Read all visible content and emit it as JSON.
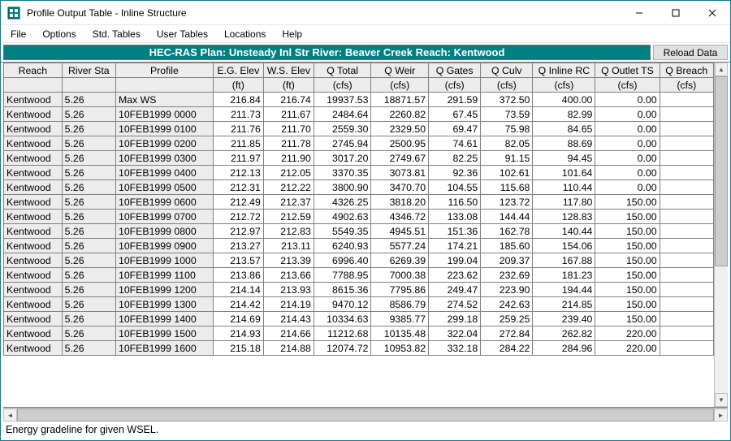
{
  "window": {
    "title": "Profile Output Table - Inline Structure"
  },
  "menu": {
    "items": [
      "File",
      "Options",
      "Std. Tables",
      "User Tables",
      "Locations",
      "Help"
    ]
  },
  "info": {
    "label": "HEC-RAS  Plan: Unsteady Inl Str    River: Beaver Creek    Reach: Kentwood",
    "reload": "Reload Data"
  },
  "columns": {
    "headers": [
      "Reach",
      "River Sta",
      "Profile",
      "E.G. Elev",
      "W.S. Elev",
      "Q Total",
      "Q Weir",
      "Q Gates",
      "Q Culv",
      "Q Inline RC",
      "Q Outlet TS",
      "Q Breach"
    ],
    "units": [
      "",
      "",
      "",
      "(ft)",
      "(ft)",
      "(cfs)",
      "(cfs)",
      "(cfs)",
      "(cfs)",
      "(cfs)",
      "(cfs)",
      "(cfs)"
    ]
  },
  "rows": [
    {
      "reach": "Kentwood",
      "sta": "5.26",
      "profile": "Max WS",
      "eg": "216.84",
      "ws": "216.74",
      "qtot": "19937.53",
      "qweir": "18871.57",
      "qgates": "291.59",
      "qculv": "372.50",
      "qinl": "400.00",
      "qout": "0.00",
      "qbr": ""
    },
    {
      "reach": "Kentwood",
      "sta": "5.26",
      "profile": "10FEB1999 0000",
      "eg": "211.73",
      "ws": "211.67",
      "qtot": "2484.64",
      "qweir": "2260.82",
      "qgates": "67.45",
      "qculv": "73.59",
      "qinl": "82.99",
      "qout": "0.00",
      "qbr": ""
    },
    {
      "reach": "Kentwood",
      "sta": "5.26",
      "profile": "10FEB1999 0100",
      "eg": "211.76",
      "ws": "211.70",
      "qtot": "2559.30",
      "qweir": "2329.50",
      "qgates": "69.47",
      "qculv": "75.98",
      "qinl": "84.65",
      "qout": "0.00",
      "qbr": ""
    },
    {
      "reach": "Kentwood",
      "sta": "5.26",
      "profile": "10FEB1999 0200",
      "eg": "211.85",
      "ws": "211.78",
      "qtot": "2745.94",
      "qweir": "2500.95",
      "qgates": "74.61",
      "qculv": "82.05",
      "qinl": "88.69",
      "qout": "0.00",
      "qbr": ""
    },
    {
      "reach": "Kentwood",
      "sta": "5.26",
      "profile": "10FEB1999 0300",
      "eg": "211.97",
      "ws": "211.90",
      "qtot": "3017.20",
      "qweir": "2749.67",
      "qgates": "82.25",
      "qculv": "91.15",
      "qinl": "94.45",
      "qout": "0.00",
      "qbr": ""
    },
    {
      "reach": "Kentwood",
      "sta": "5.26",
      "profile": "10FEB1999 0400",
      "eg": "212.13",
      "ws": "212.05",
      "qtot": "3370.35",
      "qweir": "3073.81",
      "qgates": "92.36",
      "qculv": "102.61",
      "qinl": "101.64",
      "qout": "0.00",
      "qbr": ""
    },
    {
      "reach": "Kentwood",
      "sta": "5.26",
      "profile": "10FEB1999 0500",
      "eg": "212.31",
      "ws": "212.22",
      "qtot": "3800.90",
      "qweir": "3470.70",
      "qgates": "104.55",
      "qculv": "115.68",
      "qinl": "110.44",
      "qout": "0.00",
      "qbr": ""
    },
    {
      "reach": "Kentwood",
      "sta": "5.26",
      "profile": "10FEB1999 0600",
      "eg": "212.49",
      "ws": "212.37",
      "qtot": "4326.25",
      "qweir": "3818.20",
      "qgates": "116.50",
      "qculv": "123.72",
      "qinl": "117.80",
      "qout": "150.00",
      "qbr": ""
    },
    {
      "reach": "Kentwood",
      "sta": "5.26",
      "profile": "10FEB1999 0700",
      "eg": "212.72",
      "ws": "212.59",
      "qtot": "4902.63",
      "qweir": "4346.72",
      "qgates": "133.08",
      "qculv": "144.44",
      "qinl": "128.83",
      "qout": "150.00",
      "qbr": ""
    },
    {
      "reach": "Kentwood",
      "sta": "5.26",
      "profile": "10FEB1999 0800",
      "eg": "212.97",
      "ws": "212.83",
      "qtot": "5549.35",
      "qweir": "4945.51",
      "qgates": "151.36",
      "qculv": "162.78",
      "qinl": "140.44",
      "qout": "150.00",
      "qbr": ""
    },
    {
      "reach": "Kentwood",
      "sta": "5.26",
      "profile": "10FEB1999 0900",
      "eg": "213.27",
      "ws": "213.11",
      "qtot": "6240.93",
      "qweir": "5577.24",
      "qgates": "174.21",
      "qculv": "185.60",
      "qinl": "154.06",
      "qout": "150.00",
      "qbr": ""
    },
    {
      "reach": "Kentwood",
      "sta": "5.26",
      "profile": "10FEB1999 1000",
      "eg": "213.57",
      "ws": "213.39",
      "qtot": "6996.40",
      "qweir": "6269.39",
      "qgates": "199.04",
      "qculv": "209.37",
      "qinl": "167.88",
      "qout": "150.00",
      "qbr": ""
    },
    {
      "reach": "Kentwood",
      "sta": "5.26",
      "profile": "10FEB1999 1100",
      "eg": "213.86",
      "ws": "213.66",
      "qtot": "7788.95",
      "qweir": "7000.38",
      "qgates": "223.62",
      "qculv": "232.69",
      "qinl": "181.23",
      "qout": "150.00",
      "qbr": ""
    },
    {
      "reach": "Kentwood",
      "sta": "5.26",
      "profile": "10FEB1999 1200",
      "eg": "214.14",
      "ws": "213.93",
      "qtot": "8615.36",
      "qweir": "7795.86",
      "qgates": "249.47",
      "qculv": "223.90",
      "qinl": "194.44",
      "qout": "150.00",
      "qbr": ""
    },
    {
      "reach": "Kentwood",
      "sta": "5.26",
      "profile": "10FEB1999 1300",
      "eg": "214.42",
      "ws": "214.19",
      "qtot": "9470.12",
      "qweir": "8586.79",
      "qgates": "274.52",
      "qculv": "242.63",
      "qinl": "214.85",
      "qout": "150.00",
      "qbr": ""
    },
    {
      "reach": "Kentwood",
      "sta": "5.26",
      "profile": "10FEB1999 1400",
      "eg": "214.69",
      "ws": "214.43",
      "qtot": "10334.63",
      "qweir": "9385.77",
      "qgates": "299.18",
      "qculv": "259.25",
      "qinl": "239.40",
      "qout": "150.00",
      "qbr": ""
    },
    {
      "reach": "Kentwood",
      "sta": "5.26",
      "profile": "10FEB1999 1500",
      "eg": "214.93",
      "ws": "214.66",
      "qtot": "11212.68",
      "qweir": "10135.48",
      "qgates": "322.04",
      "qculv": "272.84",
      "qinl": "262.82",
      "qout": "220.00",
      "qbr": ""
    },
    {
      "reach": "Kentwood",
      "sta": "5.26",
      "profile": "10FEB1999 1600",
      "eg": "215.18",
      "ws": "214.88",
      "qtot": "12074.72",
      "qweir": "10953.82",
      "qgates": "332.18",
      "qculv": "284.22",
      "qinl": "284.96",
      "qout": "220.00",
      "qbr": ""
    }
  ],
  "status": {
    "text": "Energy gradeline for given WSEL."
  }
}
